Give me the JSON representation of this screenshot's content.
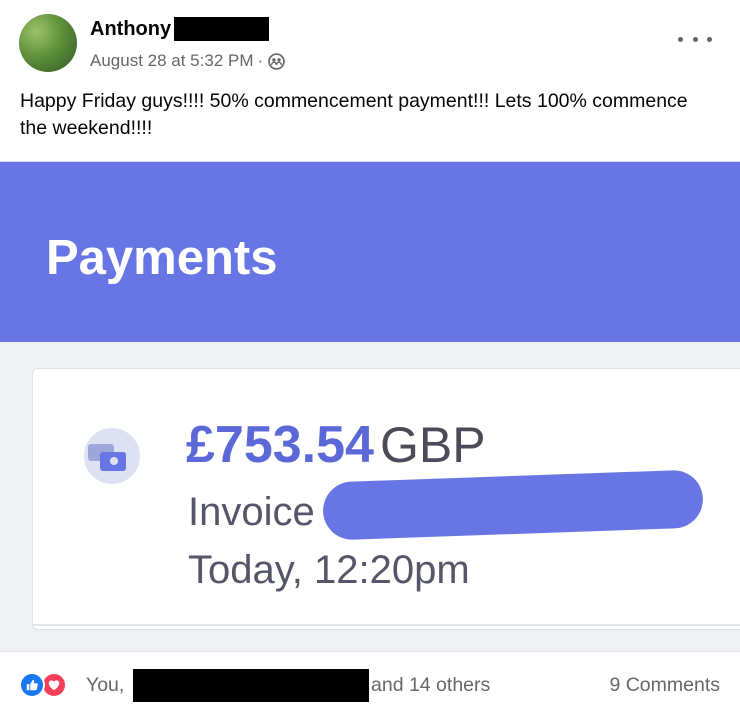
{
  "post": {
    "author_name": "Anthony",
    "timestamp": "August 28 at 5:32 PM",
    "separator": "·",
    "audience_icon": "friends-icon",
    "more_icon": "more-options-icon",
    "text": "Happy Friday guys!!!! 50% commencement payment!!! Lets 100% commence the weekend!!!!"
  },
  "image": {
    "title": "Payments",
    "header_color": "#6875e4",
    "payment": {
      "amount": "£753.54",
      "currency": "GBP",
      "invoice_label": "Invoice",
      "date": "Today, 12:20pm",
      "icon": "payment-cards-icon"
    }
  },
  "footer": {
    "reactions": [
      "like-icon",
      "love-icon"
    ],
    "you_label": "You,",
    "others_label": "and 14 others",
    "comments_label": "9 Comments"
  },
  "colors": {
    "like": "#1877f2",
    "love": "#f33e58",
    "amount": "#5c68d8"
  }
}
